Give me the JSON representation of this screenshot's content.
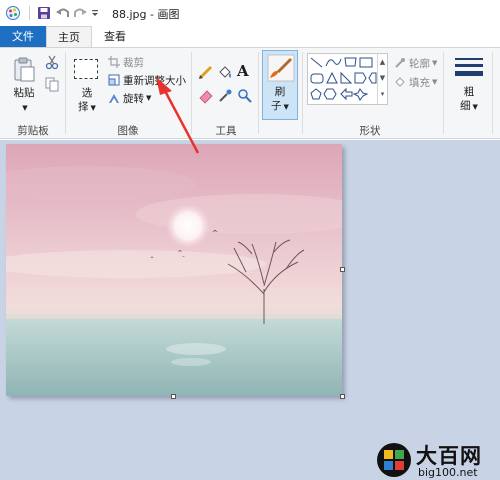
{
  "window": {
    "title": "88.jpg - 画图"
  },
  "tabs": [
    {
      "label": "文件",
      "active": false
    },
    {
      "label": "主页",
      "active": true
    },
    {
      "label": "查看",
      "active": false
    }
  ],
  "ribbon": {
    "clipboard": {
      "paste_label": "粘贴",
      "cut_icon": "scissors-icon",
      "copy_icon": "copy-icon",
      "group_label": "剪贴板"
    },
    "image": {
      "select_label_line1": "选",
      "select_label_line2": "择",
      "crop_label": "裁剪",
      "resize_label": "重新调整大小",
      "rotate_label": "旋转",
      "group_label": "图像"
    },
    "tools": {
      "group_label": "工具",
      "icons": [
        "pencil-icon",
        "fill-icon",
        "text-icon",
        "eraser-icon",
        "color-picker-icon",
        "magnifier-icon"
      ]
    },
    "brushes": {
      "label_line1": "刷",
      "label_line2": "子"
    },
    "shapes": {
      "outline_label": "轮廓",
      "fill_label": "填充",
      "group_label": "形状"
    },
    "size": {
      "label_line1": "粗",
      "label_line2": "细"
    }
  },
  "colors": {
    "file_tab": "#1e6fc2",
    "canvas_bg": "#c9d3e6",
    "arrow": "#e8322e"
  },
  "watermark": {
    "title": "大百网",
    "url": "big100.net"
  }
}
